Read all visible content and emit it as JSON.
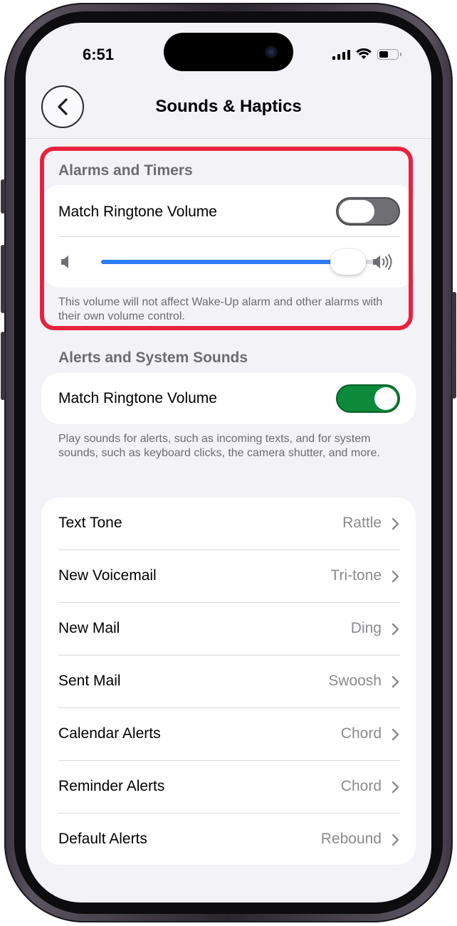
{
  "status_bar": {
    "time": "6:51"
  },
  "nav": {
    "title": "Sounds & Haptics"
  },
  "alarms_section": {
    "header": "Alarms and Timers",
    "toggle_label": "Match Ringtone Volume",
    "toggle_on": false,
    "volume_level": 0.9,
    "footnote": "This volume will not affect Wake-Up alarm and other alarms with their own volume control."
  },
  "alerts_section": {
    "header": "Alerts and System Sounds",
    "toggle_label": "Match Ringtone Volume",
    "toggle_on": true,
    "footnote": "Play sounds for alerts, such as incoming texts, and for system sounds, such as keyboard clicks, the camera shutter, and more."
  },
  "tones": [
    {
      "label": "Text Tone",
      "value": "Rattle"
    },
    {
      "label": "New Voicemail",
      "value": "Tri-tone"
    },
    {
      "label": "New Mail",
      "value": "Ding"
    },
    {
      "label": "Sent Mail",
      "value": "Swoosh"
    },
    {
      "label": "Calendar Alerts",
      "value": "Chord"
    },
    {
      "label": "Reminder Alerts",
      "value": "Chord"
    },
    {
      "label": "Default Alerts",
      "value": "Rebound"
    }
  ],
  "icons": {
    "back": "chevron-left-icon",
    "chevron": "chevron-right-icon",
    "volume_low": "speaker-low-icon",
    "volume_high": "speaker-high-icon"
  },
  "colors": {
    "accent_blue": "#2f7cf6",
    "toggle_on_green": "#0c8a3a",
    "toggle_off_gray": "#6e6e73",
    "highlight_red": "#e8223e"
  }
}
